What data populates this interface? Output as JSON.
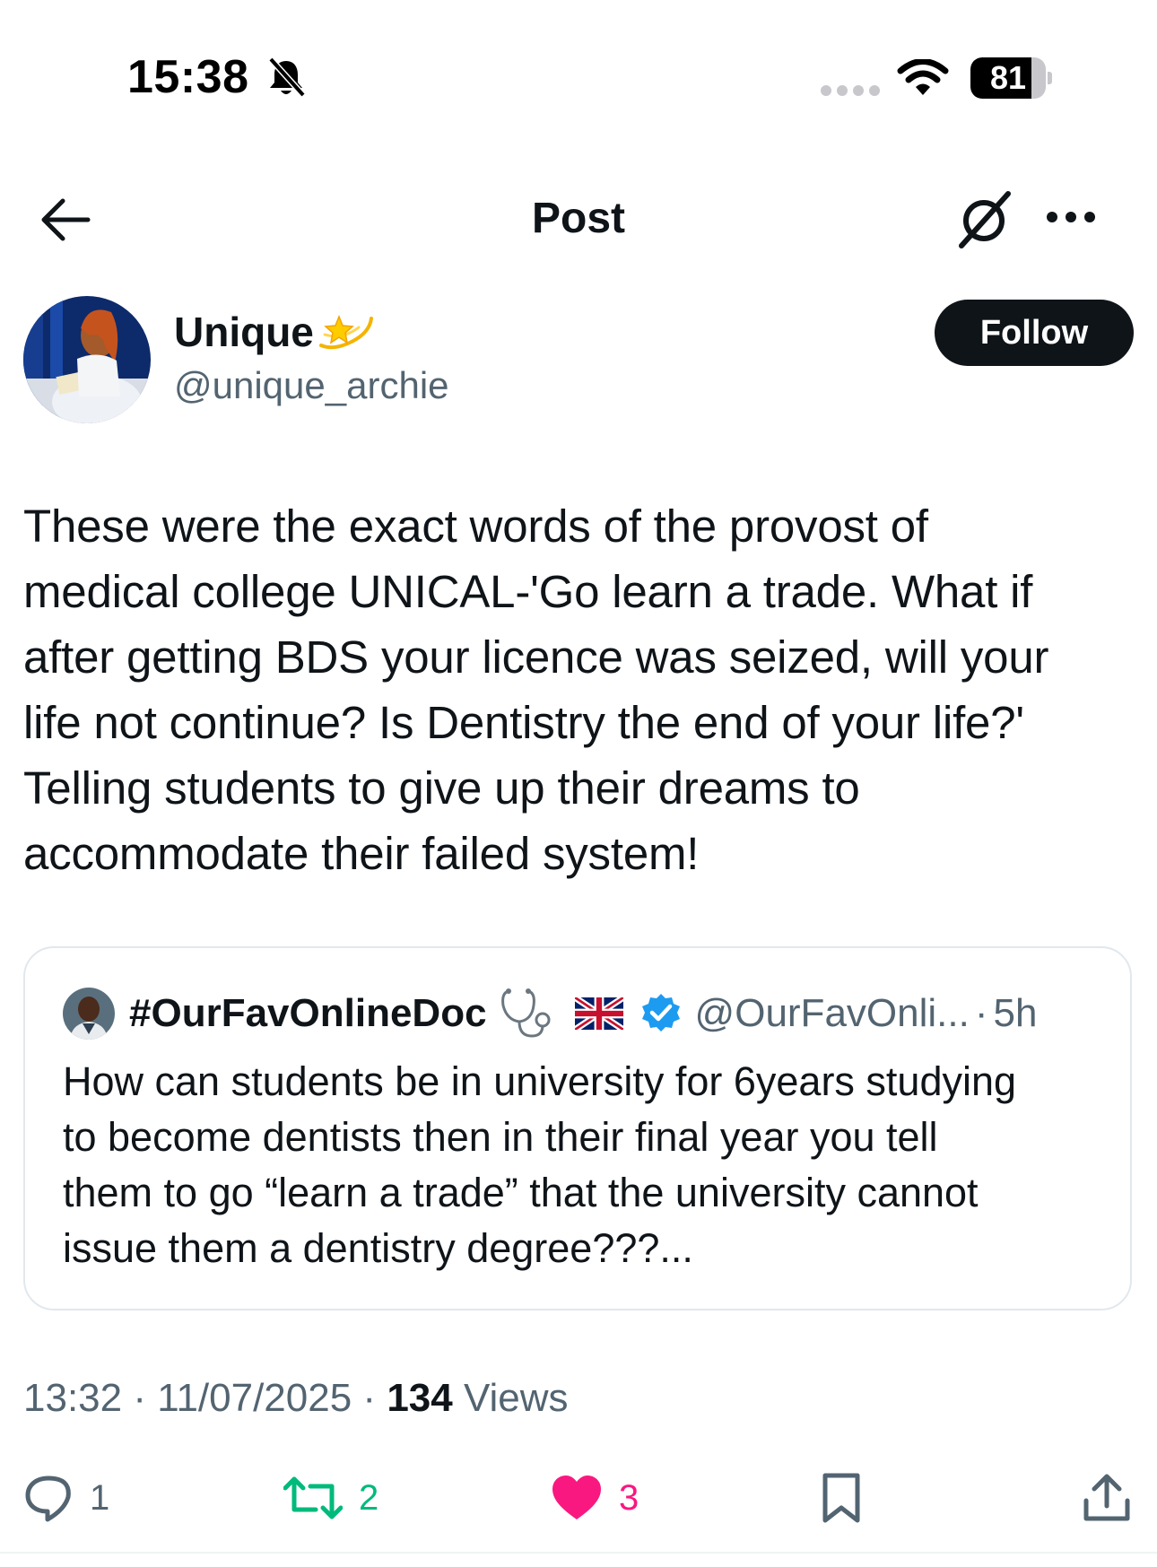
{
  "status_bar": {
    "time": "15:38",
    "battery_level": "81",
    "battery_fraction": 0.81,
    "icons": [
      "bell-slash-icon",
      "signal-dots-icon",
      "wifi-icon",
      "battery-icon"
    ]
  },
  "header": {
    "title": "Post",
    "icons": [
      "back-arrow-icon",
      "grok-icon",
      "more-icon"
    ]
  },
  "author": {
    "display_name": "Unique",
    "name_emoji": "dizzy-star-icon",
    "handle": "@unique_archie",
    "follow_label": "Follow"
  },
  "post": {
    "text_lines": [
      "These were the exact words of the provost of",
      "medical college UNICAL-'Go learn a trade. What if",
      "after getting BDS your licence was seized, will your",
      "life not continue? Is Dentistry the end of your life?'",
      "Telling students to give up their dreams to",
      "accommodate their failed system!"
    ]
  },
  "quote": {
    "display_name": "#OurFavOnlineDoc",
    "badges": [
      "stethoscope-icon",
      "uk-flag-icon",
      "verified-badge-icon"
    ],
    "handle": "@OurFavOnli...",
    "separator": "·",
    "time": "5h",
    "text_lines": [
      "How can students be in university for 6years studying",
      "to become dentists then in their final year you tell",
      "them to go “learn a trade” that the university cannot",
      "issue them a dentistry degree???..."
    ]
  },
  "meta": {
    "time": "13:32",
    "separator": "·",
    "date": "11/07/2025",
    "views_count": "134",
    "views_label": "Views"
  },
  "actions": {
    "replies": "1",
    "reposts": "2",
    "likes": "3",
    "colors": {
      "reply": "#536471",
      "repost": "#00ba7c",
      "like": "#f91880"
    }
  },
  "colors": {
    "text": "#0f1419",
    "secondary": "#536471",
    "verified": "#1d9bf0",
    "border": "#e1e8ed"
  }
}
